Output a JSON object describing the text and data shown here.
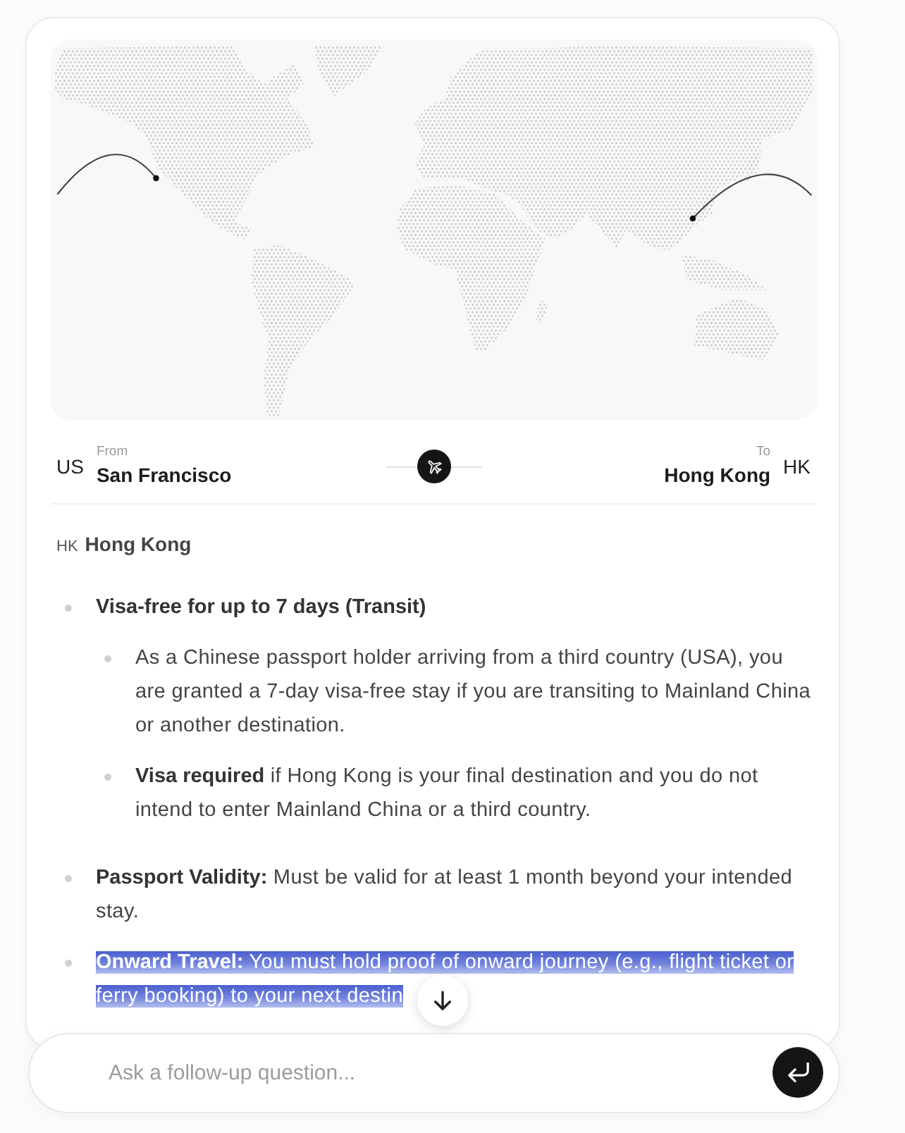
{
  "route": {
    "origin": {
      "country_code": "US",
      "label": "From",
      "city": "San Francisco"
    },
    "destination": {
      "country_code": "HK",
      "label": "To",
      "city": "Hong Kong"
    }
  },
  "destination_section": {
    "country_code": "HK",
    "name": "Hong Kong"
  },
  "requirements": [
    {
      "kind": "heading",
      "text": "Visa-free for up to 7 days (Transit)",
      "selected": false,
      "children": [
        {
          "kind": "text",
          "text": "As a Chinese passport holder arriving from a third country (USA), you are granted a 7-day visa-free stay if you are transiting to Mainland China or another destination.",
          "selected": false
        },
        {
          "kind": "text",
          "text": "**Visa required** if Hong Kong is your final destination and you do not intend to enter Mainland China or a third country.",
          "selected": false
        }
      ]
    },
    {
      "kind": "text",
      "text": "**Passport Validity:** Must be valid for at least 1 month beyond your intended stay.",
      "selected": false
    },
    {
      "kind": "text",
      "text": "**Onward Travel:** You must hold proof of onward journey (e.g., flight ticket or ferry booking) to your next destin",
      "selected": true
    }
  ],
  "composer": {
    "placeholder": "Ask a follow-up question..."
  }
}
